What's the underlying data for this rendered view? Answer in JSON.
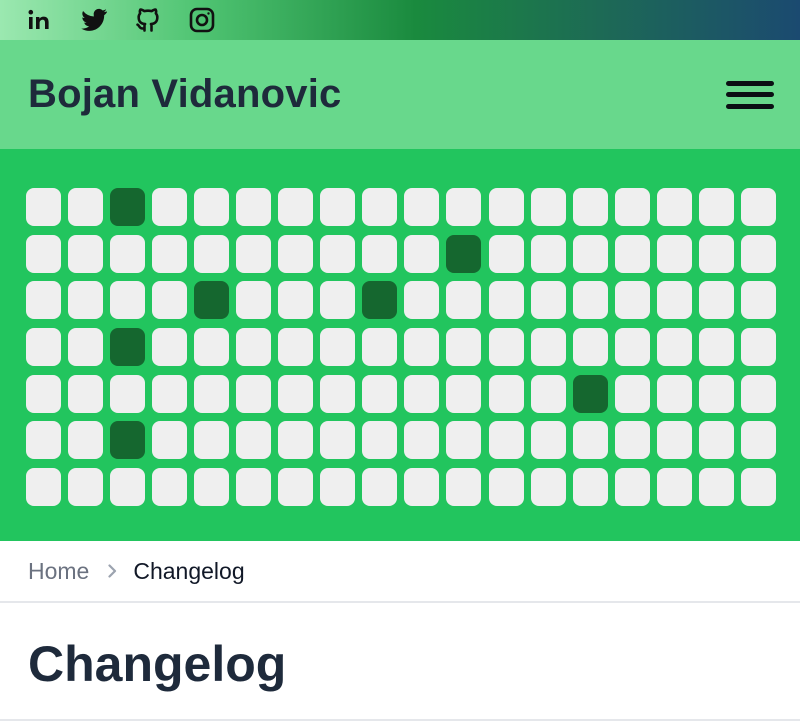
{
  "social": [
    {
      "name": "linkedin-icon"
    },
    {
      "name": "twitter-icon"
    },
    {
      "name": "github-icon"
    },
    {
      "name": "instagram-icon"
    }
  ],
  "header": {
    "title": "Bojan Vidanovic",
    "menu_icon": "hamburger-menu-icon"
  },
  "activity_grid": {
    "rows": 7,
    "columns": 18,
    "active_cells": [
      [
        0,
        2
      ],
      [
        1,
        10
      ],
      [
        2,
        4
      ],
      [
        2,
        8
      ],
      [
        3,
        2
      ],
      [
        4,
        13
      ],
      [
        5,
        2
      ]
    ],
    "colors": {
      "inactive": "#efefef",
      "active": "#15672f",
      "background": "#22c55e"
    }
  },
  "breadcrumb": {
    "home": "Home",
    "separator_icon": "chevron-right-icon",
    "current": "Changelog"
  },
  "page": {
    "title": "Changelog"
  },
  "colors": {
    "header_bg": "#68d88c",
    "title_text": "#1e2a3b"
  }
}
